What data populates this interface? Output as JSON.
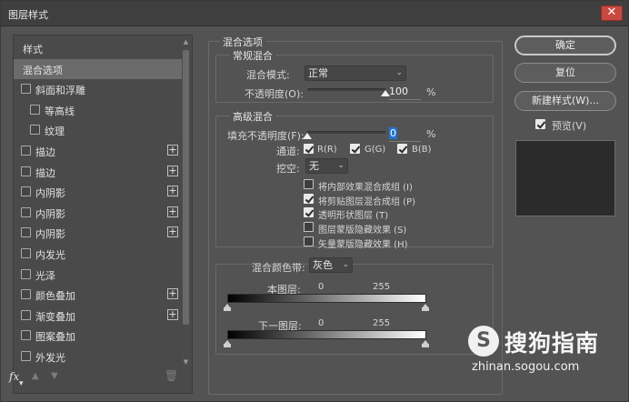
{
  "window": {
    "title": "图层样式",
    "close_glyph": "✕"
  },
  "left_panel": {
    "items": [
      {
        "label": "样式",
        "checkbox": false,
        "plus": false,
        "indent": 0,
        "selected": false
      },
      {
        "label": "混合选项",
        "checkbox": false,
        "plus": false,
        "indent": 0,
        "selected": true
      },
      {
        "label": "斜面和浮雕",
        "checkbox": true,
        "plus": false,
        "indent": 0,
        "selected": false
      },
      {
        "label": "等高线",
        "checkbox": true,
        "plus": false,
        "indent": 1,
        "selected": false
      },
      {
        "label": "纹理",
        "checkbox": true,
        "plus": false,
        "indent": 1,
        "selected": false
      },
      {
        "label": "描边",
        "checkbox": true,
        "plus": true,
        "indent": 0,
        "selected": false
      },
      {
        "label": "描边",
        "checkbox": true,
        "plus": true,
        "indent": 0,
        "selected": false
      },
      {
        "label": "内阴影",
        "checkbox": true,
        "plus": true,
        "indent": 0,
        "selected": false
      },
      {
        "label": "内阴影",
        "checkbox": true,
        "plus": true,
        "indent": 0,
        "selected": false
      },
      {
        "label": "内阴影",
        "checkbox": true,
        "plus": true,
        "indent": 0,
        "selected": false
      },
      {
        "label": "内发光",
        "checkbox": true,
        "plus": false,
        "indent": 0,
        "selected": false
      },
      {
        "label": "光泽",
        "checkbox": true,
        "plus": false,
        "indent": 0,
        "selected": false
      },
      {
        "label": "颜色叠加",
        "checkbox": true,
        "plus": true,
        "indent": 0,
        "selected": false
      },
      {
        "label": "渐变叠加",
        "checkbox": true,
        "plus": true,
        "indent": 0,
        "selected": false
      },
      {
        "label": "图案叠加",
        "checkbox": true,
        "plus": false,
        "indent": 0,
        "selected": false
      },
      {
        "label": "外发光",
        "checkbox": true,
        "plus": false,
        "indent": 0,
        "selected": false
      }
    ],
    "footer": {
      "fx": "fx",
      "fx_menu": "▾",
      "up": "▲",
      "down": "▼",
      "trash": "🗑"
    }
  },
  "blending": {
    "section_title": "混合选项",
    "general": {
      "title": "常规混合",
      "mode_label": "混合模式:",
      "mode_value": "正常",
      "opacity_label": "不透明度(O):",
      "opacity_value": "100",
      "opacity_unit": "%",
      "opacity_level": 1.0
    },
    "advanced": {
      "title": "高级混合",
      "fill_label": "填充不透明度(F):",
      "fill_value": "0",
      "fill_unit": "%",
      "fill_level": 0.0,
      "channels_label": "通道:",
      "channels": [
        {
          "label": "R(R)",
          "checked": true
        },
        {
          "label": "G(G)",
          "checked": true
        },
        {
          "label": "B(B)",
          "checked": true
        }
      ],
      "knockout_label": "挖空:",
      "knockout_value": "无",
      "options": [
        {
          "label": "将内部效果混合成组 (I)",
          "checked": false
        },
        {
          "label": "将剪贴图层混合成组 (P)",
          "checked": true
        },
        {
          "label": "透明形状图层 (T)",
          "checked": true
        },
        {
          "label": "图层蒙版隐藏效果 (S)",
          "checked": false
        },
        {
          "label": "矢量蒙版隐藏效果 (H)",
          "checked": false
        }
      ]
    },
    "blend_if": {
      "label": "混合颜色带:",
      "value": "灰色",
      "this_layer": {
        "label": "本图层:",
        "low": "0",
        "high": "255"
      },
      "underlying": {
        "label": "下一图层:",
        "low": "0",
        "high": "255"
      }
    }
  },
  "buttons": {
    "ok": "确定",
    "reset": "复位",
    "new_style": "新建样式(W)...",
    "preview_label": "预览(V)",
    "preview_checked": true
  },
  "watermark": {
    "logo": "S",
    "title": "搜狗指南",
    "url": "zhinan.sogou.com"
  }
}
